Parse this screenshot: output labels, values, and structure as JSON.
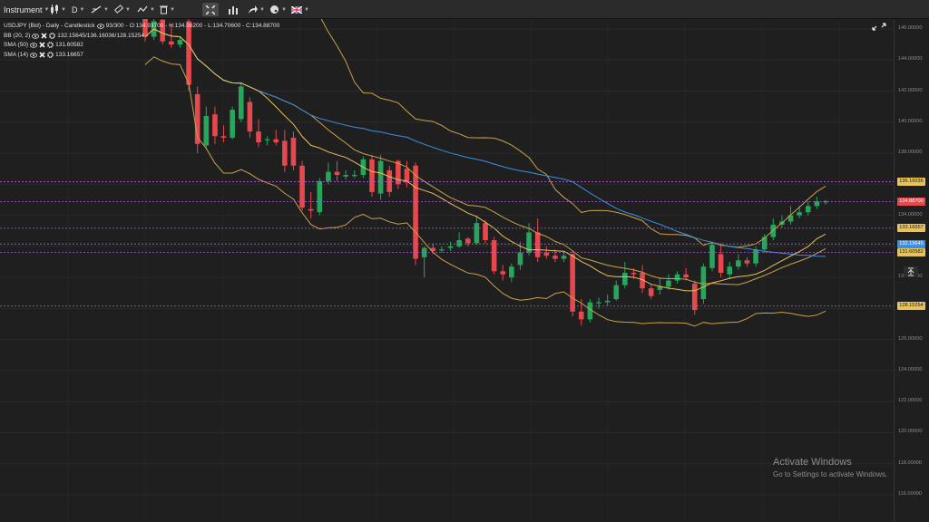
{
  "toolbar": {
    "instrument_label": "Instrument",
    "timeframe_label": "D",
    "flag_icon": "uk-flag-icon"
  },
  "legend": {
    "main": "USDJPY (Bid) - Daily - Candlestick",
    "bars": "93/300",
    "ohlc": "O:134.93700 - H:134.96200 - L:134.70600 - C:134.88700",
    "indicators": [
      {
        "name": "BB (20, 2)",
        "values": "132.15645/136.16036/128.15254"
      },
      {
        "name": "SMA (50)",
        "values": "131.60582"
      },
      {
        "name": "SMA (14)",
        "values": "133.16657"
      }
    ]
  },
  "price_tags": [
    {
      "text": "136.16036",
      "color": "#e8c25a",
      "text_color": "#1a1a1a"
    },
    {
      "text": "134.88700",
      "color": "#e5484d",
      "text_color": "#ffffff"
    },
    {
      "text": "133.16657",
      "color": "#e8c25a",
      "text_color": "#1a1a1a"
    },
    {
      "text": "132.15645",
      "color": "#3d8fe0",
      "text_color": "#ffffff"
    },
    {
      "text": "131.60582",
      "color": "#e8c25a",
      "text_color": "#1a1a1a"
    },
    {
      "text": "128.15254",
      "color": "#e8c25a",
      "text_color": "#1a1a1a"
    }
  ],
  "y_axis": {
    "ticks": [
      "146.00000",
      "144.00000",
      "142.00000",
      "140.00000",
      "138.00000",
      "136.00000",
      "134.00000",
      "132.00000",
      "130.00000",
      "128.00000",
      "126.00000",
      "124.00000",
      "122.00000",
      "120.00000",
      "118.00000",
      "116.00000"
    ],
    "ymin": 115,
    "ymax": 147
  },
  "watermark": {
    "line1": "Activate Windows",
    "line2": "Go to Settings to activate Windows."
  },
  "chart_data": {
    "type": "candlestick",
    "symbol": "USDJPY",
    "candles": [
      {
        "o": 147.0,
        "h": 147.2,
        "c": 145.5,
        "l": 145.2
      },
      {
        "o": 145.5,
        "h": 146.8,
        "c": 146.5,
        "l": 145.3
      },
      {
        "o": 146.6,
        "h": 146.9,
        "c": 145.2,
        "l": 145.0
      },
      {
        "o": 145.2,
        "h": 146.3,
        "c": 145.0,
        "l": 144.8
      },
      {
        "o": 145.0,
        "h": 145.5,
        "c": 145.3,
        "l": 144.8
      },
      {
        "o": 146.5,
        "h": 147.0,
        "c": 142.4,
        "l": 142.0
      },
      {
        "o": 141.8,
        "h": 142.3,
        "c": 138.6,
        "l": 138.0
      },
      {
        "o": 138.5,
        "h": 141.0,
        "c": 140.4,
        "l": 138.3
      },
      {
        "o": 140.5,
        "h": 141.0,
        "c": 139.1,
        "l": 138.6
      },
      {
        "o": 139.1,
        "h": 139.8,
        "c": 139.0,
        "l": 138.7
      },
      {
        "o": 139.0,
        "h": 141.0,
        "c": 140.8,
        "l": 138.9
      },
      {
        "o": 140.2,
        "h": 142.6,
        "c": 142.3,
        "l": 140.0
      },
      {
        "o": 141.3,
        "h": 141.6,
        "c": 139.4,
        "l": 139.0
      },
      {
        "o": 139.4,
        "h": 140.2,
        "c": 138.7,
        "l": 138.4
      },
      {
        "o": 138.9,
        "h": 139.1,
        "c": 138.9,
        "l": 138.5
      },
      {
        "o": 138.9,
        "h": 139.5,
        "c": 138.7,
        "l": 138.5
      },
      {
        "o": 138.8,
        "h": 139.5,
        "c": 137.2,
        "l": 136.8
      },
      {
        "o": 139.0,
        "h": 139.4,
        "c": 137.2,
        "l": 136.9
      },
      {
        "o": 137.2,
        "h": 137.5,
        "c": 134.5,
        "l": 134.3
      },
      {
        "o": 134.4,
        "h": 135.5,
        "c": 134.3,
        "l": 133.8
      },
      {
        "o": 134.2,
        "h": 136.4,
        "c": 136.2,
        "l": 134.0
      },
      {
        "o": 136.2,
        "h": 137.4,
        "c": 136.8,
        "l": 136.0
      },
      {
        "o": 136.8,
        "h": 137.5,
        "c": 136.6,
        "l": 136.2
      },
      {
        "o": 136.5,
        "h": 136.9,
        "c": 136.6,
        "l": 136.3
      },
      {
        "o": 136.6,
        "h": 136.9,
        "c": 136.6,
        "l": 136.4
      },
      {
        "o": 136.6,
        "h": 137.8,
        "c": 137.6,
        "l": 136.4
      },
      {
        "o": 137.6,
        "h": 137.9,
        "c": 135.5,
        "l": 135.2
      },
      {
        "o": 135.4,
        "h": 137.9,
        "c": 137.5,
        "l": 135.0
      },
      {
        "o": 136.9,
        "h": 137.2,
        "c": 135.5,
        "l": 135.2
      },
      {
        "o": 137.5,
        "h": 137.6,
        "c": 136.0,
        "l": 135.7
      },
      {
        "o": 137.0,
        "h": 137.5,
        "c": 136.1,
        "l": 135.8
      },
      {
        "o": 137.2,
        "h": 137.4,
        "c": 131.2,
        "l": 130.8
      },
      {
        "o": 131.3,
        "h": 132.0,
        "c": 131.9,
        "l": 130.0
      },
      {
        "o": 131.9,
        "h": 132.2,
        "c": 131.7,
        "l": 131.5
      },
      {
        "o": 131.8,
        "h": 132.0,
        "c": 131.8,
        "l": 131.6
      },
      {
        "o": 131.9,
        "h": 132.3,
        "c": 132.0,
        "l": 131.7
      },
      {
        "o": 132.0,
        "h": 132.9,
        "c": 132.4,
        "l": 131.9
      },
      {
        "o": 132.5,
        "h": 132.6,
        "c": 132.2,
        "l": 132.0
      },
      {
        "o": 132.2,
        "h": 134.0,
        "c": 133.5,
        "l": 132.1
      },
      {
        "o": 133.5,
        "h": 133.7,
        "c": 132.4,
        "l": 132.2
      },
      {
        "o": 132.4,
        "h": 132.6,
        "c": 130.4,
        "l": 130.2
      },
      {
        "o": 130.4,
        "h": 130.8,
        "c": 130.2,
        "l": 129.8
      },
      {
        "o": 130.0,
        "h": 130.9,
        "c": 130.7,
        "l": 129.7
      },
      {
        "o": 130.8,
        "h": 132.3,
        "c": 131.6,
        "l": 130.5
      },
      {
        "o": 131.6,
        "h": 133.5,
        "c": 132.9,
        "l": 131.4
      },
      {
        "o": 132.9,
        "h": 133.8,
        "c": 131.3,
        "l": 131.0
      },
      {
        "o": 131.6,
        "h": 132.0,
        "c": 131.4,
        "l": 131.2
      },
      {
        "o": 131.4,
        "h": 131.8,
        "c": 131.2,
        "l": 131.0
      },
      {
        "o": 131.2,
        "h": 131.6,
        "c": 131.4,
        "l": 131.0
      },
      {
        "o": 131.5,
        "h": 131.7,
        "c": 127.8,
        "l": 127.5
      },
      {
        "o": 127.8,
        "h": 128.6,
        "c": 127.3,
        "l": 126.9
      },
      {
        "o": 127.3,
        "h": 128.6,
        "c": 128.4,
        "l": 127.1
      },
      {
        "o": 128.4,
        "h": 128.7,
        "c": 128.4,
        "l": 128.0
      },
      {
        "o": 128.4,
        "h": 128.9,
        "c": 128.5,
        "l": 128.2
      },
      {
        "o": 128.6,
        "h": 129.8,
        "c": 129.5,
        "l": 128.5
      },
      {
        "o": 129.5,
        "h": 131.0,
        "c": 130.3,
        "l": 129.3
      },
      {
        "o": 130.3,
        "h": 130.6,
        "c": 130.2,
        "l": 129.9
      },
      {
        "o": 130.3,
        "h": 130.8,
        "c": 129.3,
        "l": 129.0
      },
      {
        "o": 129.3,
        "h": 129.5,
        "c": 128.8,
        "l": 128.6
      },
      {
        "o": 129.2,
        "h": 130.0,
        "c": 129.4,
        "l": 128.9
      },
      {
        "o": 129.4,
        "h": 130.2,
        "c": 129.8,
        "l": 129.2
      },
      {
        "o": 129.8,
        "h": 130.4,
        "c": 130.2,
        "l": 129.6
      },
      {
        "o": 130.2,
        "h": 130.6,
        "c": 130.0,
        "l": 129.8
      },
      {
        "o": 129.6,
        "h": 129.8,
        "c": 127.9,
        "l": 127.6
      },
      {
        "o": 128.6,
        "h": 130.9,
        "c": 130.7,
        "l": 128.3
      },
      {
        "o": 130.6,
        "h": 132.3,
        "c": 132.1,
        "l": 130.4
      },
      {
        "o": 131.5,
        "h": 132.2,
        "c": 130.3,
        "l": 130.0
      },
      {
        "o": 130.2,
        "h": 131.0,
        "c": 130.7,
        "l": 129.9
      },
      {
        "o": 130.7,
        "h": 131.5,
        "c": 131.1,
        "l": 130.5
      },
      {
        "o": 131.1,
        "h": 131.3,
        "c": 130.9,
        "l": 130.7
      },
      {
        "o": 130.9,
        "h": 132.0,
        "c": 131.8,
        "l": 130.7
      },
      {
        "o": 131.8,
        "h": 132.8,
        "c": 132.6,
        "l": 131.6
      },
      {
        "o": 132.6,
        "h": 133.8,
        "c": 133.4,
        "l": 132.4
      },
      {
        "o": 133.4,
        "h": 134.0,
        "c": 133.6,
        "l": 133.2
      },
      {
        "o": 133.6,
        "h": 134.6,
        "c": 134.0,
        "l": 133.4
      },
      {
        "o": 134.0,
        "h": 134.6,
        "c": 134.2,
        "l": 133.8
      },
      {
        "o": 134.2,
        "h": 134.9,
        "c": 134.6,
        "l": 134.0
      },
      {
        "o": 134.6,
        "h": 135.2,
        "c": 134.9,
        "l": 134.4
      },
      {
        "o": 134.9,
        "h": 135.0,
        "c": 134.9,
        "l": 134.7
      }
    ],
    "colors": {
      "up": "#26a65b",
      "down": "#e5484d",
      "bb": "#c9a24a",
      "sma50": "#3d8fe0",
      "sma14": "#e8c25a"
    }
  }
}
